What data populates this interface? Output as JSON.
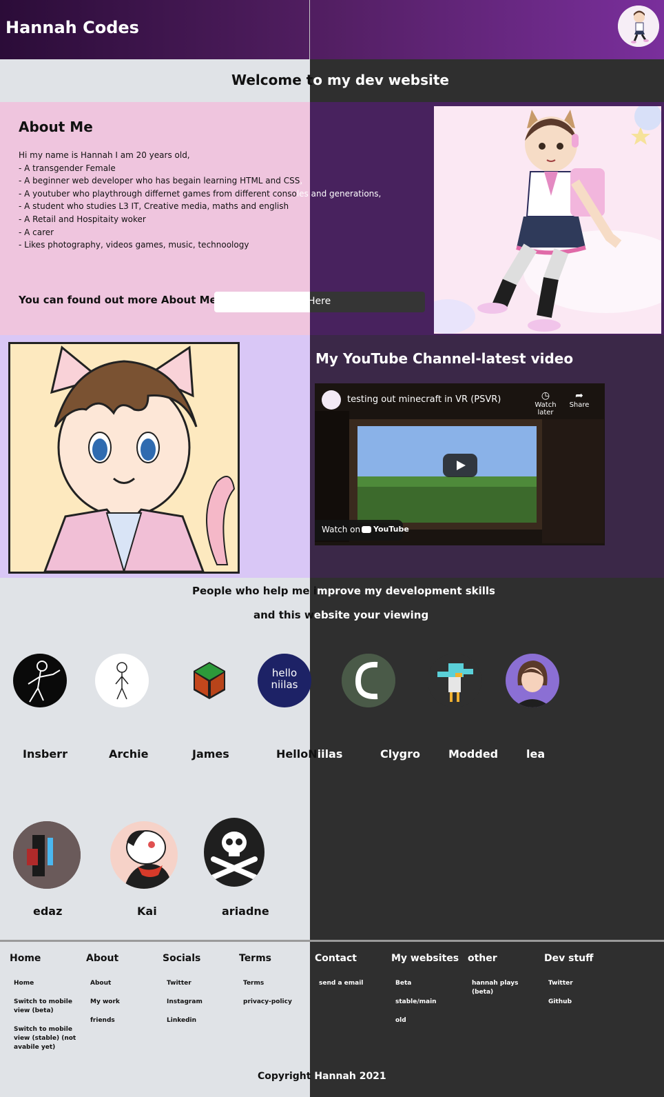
{
  "header": {
    "title": "Hannah Codes"
  },
  "welcome": {
    "left": "Welcome t",
    "right": "o my dev website"
  },
  "about": {
    "heading": "About Me",
    "lines": [
      {
        "l": "Hi my name is Hannah I am 20 years old,",
        "r": ""
      },
      {
        "l": "- A transgender Female",
        "r": ""
      },
      {
        "l": "- A beginner web developer who has begain learning HTML and CSS",
        "r": ","
      },
      {
        "l": "- A youtuber who playthrough differnet games from different conso",
        "r": "les and generations,"
      },
      {
        "l": "- A student who studies L3 IT, Creative media, maths and english",
        "r": ""
      },
      {
        "l": "- A Retail and Hospitaity woker",
        "r": ""
      },
      {
        "l": "- A carer",
        "r": ""
      },
      {
        "l": "- Likes photography, videos games, music, technoology",
        "r": ""
      }
    ],
    "more_text": "You can found out more About Me",
    "here_button": "Here"
  },
  "youtube": {
    "heading": "My YouTube Channel-latest video",
    "video_title": "testing out minecraft in VR (PSVR)",
    "watch_later": "Watch later",
    "share": "Share",
    "watch_on": "Watch on",
    "youtube_brand": "YouTube"
  },
  "helpers": {
    "line1_left": "People who help me i",
    "line1_right": "mprove my development skills",
    "line2_left": "and this w",
    "line2_right": "ebsite your viewing",
    "people": [
      {
        "name": "Insberr"
      },
      {
        "name": "Archie"
      },
      {
        "name": "James"
      },
      {
        "name_left": "HelloN",
        "name_right": "iilas",
        "logo_line1": "hello",
        "logo_line2": "niilas"
      },
      {
        "name": "Clygro"
      },
      {
        "name": "Modded"
      },
      {
        "name": "lea"
      },
      {
        "name": "edaz"
      },
      {
        "name": "Kai"
      },
      {
        "name": "ariadne"
      }
    ]
  },
  "footer": {
    "columns": [
      {
        "heading": "Home",
        "links": [
          "Home",
          "Switch to mobile view (beta)",
          "Switch to mobile view (stable) (not avabile yet)"
        ]
      },
      {
        "heading": "About",
        "links": [
          "About",
          "My work",
          "friends"
        ]
      },
      {
        "heading": "Socials",
        "links": [
          "Twitter",
          "Instagram",
          "Linkedin"
        ]
      },
      {
        "heading": "Terms",
        "links": [
          "Terms",
          "privacy-policy"
        ]
      },
      {
        "heading": "Contact",
        "links": [
          "send a email"
        ]
      },
      {
        "heading": "My websites",
        "links": [
          "Beta",
          "stable/main",
          "old"
        ]
      },
      {
        "heading": "other",
        "links": [
          "hannah plays (beta)"
        ]
      },
      {
        "heading": "Dev stuff",
        "links": [
          "Twitter",
          "Github"
        ]
      }
    ],
    "copyright_left": "Copyright ",
    "copyright_right": "Hannah 2021"
  },
  "colors": {
    "header_start": "#2b0c38",
    "header_end": "#7a2f9c",
    "dark_bg": "#2f2f2f",
    "light_bg": "#e0e3e7",
    "about_pink": "#efc5de",
    "about_purple": "#48225e"
  }
}
